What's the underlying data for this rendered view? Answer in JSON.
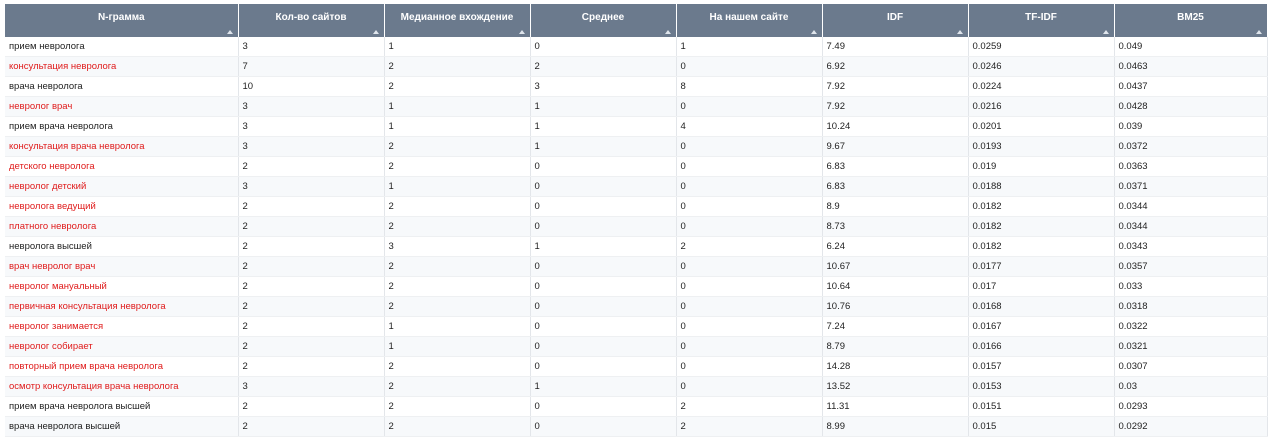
{
  "colors": {
    "header_bg": "#6b7a8d",
    "header_text": "#ffffff",
    "highlight_text": "#e01b1b",
    "normal_text": "#222222"
  },
  "columns": [
    "N-грамма",
    "Кол-во сайтов",
    "Медианное вхождение",
    "Среднее",
    "На нашем сайте",
    "IDF",
    "TF-IDF",
    "BM25"
  ],
  "rows": [
    {
      "ngram": "прием невролога",
      "highlight": false,
      "sites": "3",
      "median": "1",
      "avg": "0",
      "ours": "1",
      "idf": "7.49",
      "tfidf": "0.0259",
      "bm25": "0.049"
    },
    {
      "ngram": "консультация невролога",
      "highlight": true,
      "sites": "7",
      "median": "2",
      "avg": "2",
      "ours": "0",
      "idf": "6.92",
      "tfidf": "0.0246",
      "bm25": "0.0463"
    },
    {
      "ngram": "врача невролога",
      "highlight": false,
      "sites": "10",
      "median": "2",
      "avg": "3",
      "ours": "8",
      "idf": "7.92",
      "tfidf": "0.0224",
      "bm25": "0.0437"
    },
    {
      "ngram": "невролог врач",
      "highlight": true,
      "sites": "3",
      "median": "1",
      "avg": "1",
      "ours": "0",
      "idf": "7.92",
      "tfidf": "0.0216",
      "bm25": "0.0428"
    },
    {
      "ngram": "прием врача невролога",
      "highlight": false,
      "sites": "3",
      "median": "1",
      "avg": "1",
      "ours": "4",
      "idf": "10.24",
      "tfidf": "0.0201",
      "bm25": "0.039"
    },
    {
      "ngram": "консультация врача невролога",
      "highlight": true,
      "sites": "3",
      "median": "2",
      "avg": "1",
      "ours": "0",
      "idf": "9.67",
      "tfidf": "0.0193",
      "bm25": "0.0372"
    },
    {
      "ngram": "детского невролога",
      "highlight": true,
      "sites": "2",
      "median": "2",
      "avg": "0",
      "ours": "0",
      "idf": "6.83",
      "tfidf": "0.019",
      "bm25": "0.0363"
    },
    {
      "ngram": "невролог детский",
      "highlight": true,
      "sites": "3",
      "median": "1",
      "avg": "0",
      "ours": "0",
      "idf": "6.83",
      "tfidf": "0.0188",
      "bm25": "0.0371"
    },
    {
      "ngram": "невролога ведущий",
      "highlight": true,
      "sites": "2",
      "median": "2",
      "avg": "0",
      "ours": "0",
      "idf": "8.9",
      "tfidf": "0.0182",
      "bm25": "0.0344"
    },
    {
      "ngram": "платного невролога",
      "highlight": true,
      "sites": "2",
      "median": "2",
      "avg": "0",
      "ours": "0",
      "idf": "8.73",
      "tfidf": "0.0182",
      "bm25": "0.0344"
    },
    {
      "ngram": "невролога высшей",
      "highlight": false,
      "sites": "2",
      "median": "3",
      "avg": "1",
      "ours": "2",
      "idf": "6.24",
      "tfidf": "0.0182",
      "bm25": "0.0343"
    },
    {
      "ngram": "врач невролог врач",
      "highlight": true,
      "sites": "2",
      "median": "2",
      "avg": "0",
      "ours": "0",
      "idf": "10.67",
      "tfidf": "0.0177",
      "bm25": "0.0357"
    },
    {
      "ngram": "невролог мануальный",
      "highlight": true,
      "sites": "2",
      "median": "2",
      "avg": "0",
      "ours": "0",
      "idf": "10.64",
      "tfidf": "0.017",
      "bm25": "0.033"
    },
    {
      "ngram": "первичная консультация невролога",
      "highlight": true,
      "sites": "2",
      "median": "2",
      "avg": "0",
      "ours": "0",
      "idf": "10.76",
      "tfidf": "0.0168",
      "bm25": "0.0318"
    },
    {
      "ngram": "невролог занимается",
      "highlight": true,
      "sites": "2",
      "median": "1",
      "avg": "0",
      "ours": "0",
      "idf": "7.24",
      "tfidf": "0.0167",
      "bm25": "0.0322"
    },
    {
      "ngram": "невролог собирает",
      "highlight": true,
      "sites": "2",
      "median": "1",
      "avg": "0",
      "ours": "0",
      "idf": "8.79",
      "tfidf": "0.0166",
      "bm25": "0.0321"
    },
    {
      "ngram": "повторный прием врача невролога",
      "highlight": true,
      "sites": "2",
      "median": "2",
      "avg": "0",
      "ours": "0",
      "idf": "14.28",
      "tfidf": "0.0157",
      "bm25": "0.0307"
    },
    {
      "ngram": "осмотр консультация врача невролога",
      "highlight": true,
      "sites": "3",
      "median": "2",
      "avg": "1",
      "ours": "0",
      "idf": "13.52",
      "tfidf": "0.0153",
      "bm25": "0.03"
    },
    {
      "ngram": "прием врача невролога высшей",
      "highlight": false,
      "sites": "2",
      "median": "2",
      "avg": "0",
      "ours": "2",
      "idf": "11.31",
      "tfidf": "0.0151",
      "bm25": "0.0293"
    },
    {
      "ngram": "врача невролога высшей",
      "highlight": false,
      "sites": "2",
      "median": "2",
      "avg": "0",
      "ours": "2",
      "idf": "8.99",
      "tfidf": "0.015",
      "bm25": "0.0292"
    }
  ]
}
